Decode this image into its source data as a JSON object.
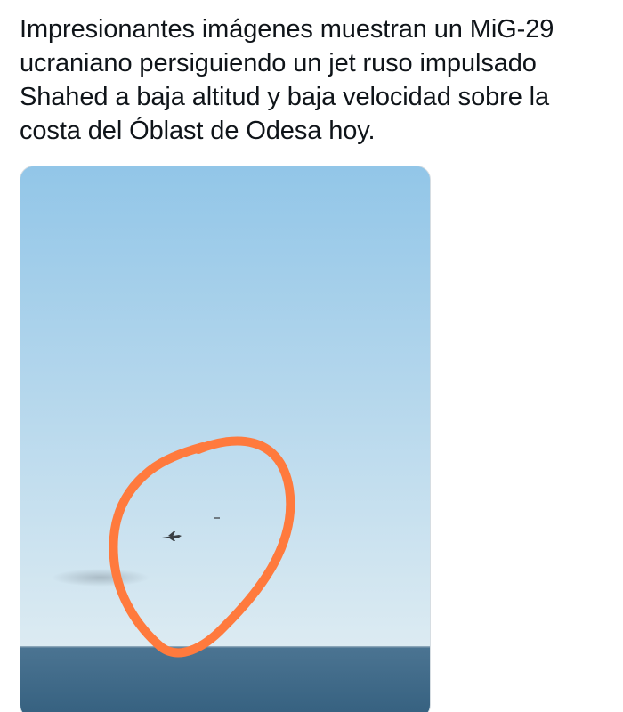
{
  "tweet": {
    "text": "Impresionantes imágenes muestran un MiG-29 ucraniano persiguiendo un jet ruso impulsado Shahed a baja altitud y baja velocidad sobre la costa del Óblast de Odesa hoy."
  },
  "media": {
    "type": "photo",
    "colors": {
      "sky_top": "#92c6e8",
      "sky_bottom": "#d9e9f2",
      "sea": "#3f6887",
      "annotation_circle": "#ff7a3d"
    }
  }
}
